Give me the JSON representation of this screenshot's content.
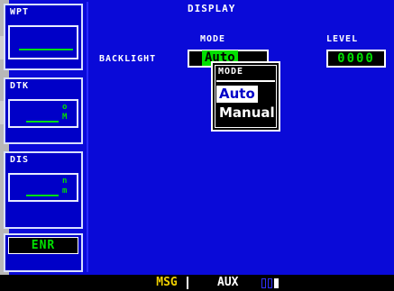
{
  "page": {
    "title": "DISPLAY"
  },
  "fields": {
    "wpt": {
      "title": "WPT"
    },
    "dtk": {
      "title": "DTK",
      "unit_top": "o",
      "unit_bottom": "M"
    },
    "dis": {
      "title": "DIS",
      "unit_top": "n",
      "unit_bottom": "m"
    }
  },
  "cdi_mode": "ENR",
  "headers": {
    "mode": "MODE",
    "level": "LEVEL"
  },
  "backlight": {
    "label": "BACKLIGHT",
    "mode_value": "Auto",
    "level_value": "0000"
  },
  "popup": {
    "title": "MODE",
    "options": [
      "Auto",
      "Manual"
    ],
    "selected": "Auto"
  },
  "status_bar": {
    "msg": "MSG",
    "aux": "AUX"
  },
  "colors": {
    "screen": "#0a0ad8",
    "value": "#00e000",
    "msg": "#f0d000"
  }
}
